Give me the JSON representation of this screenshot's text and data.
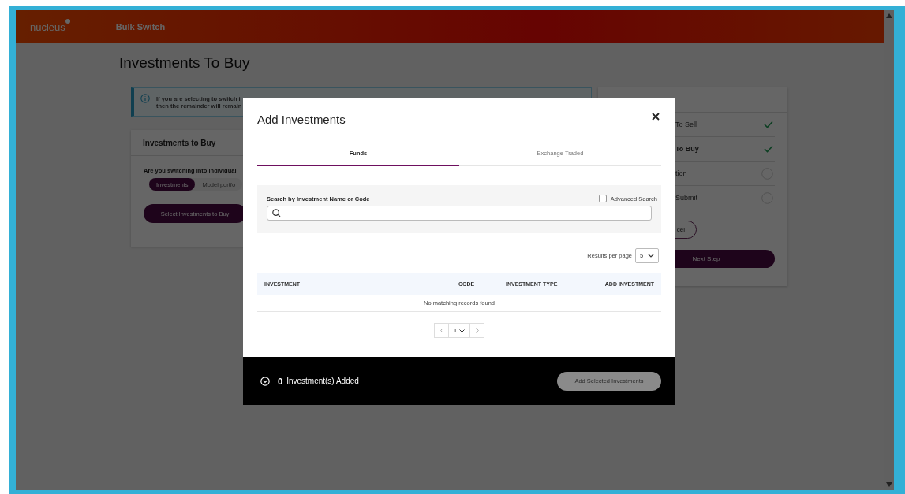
{
  "header": {
    "logo": "nucleus",
    "nav": "Bulk Switch"
  },
  "page": {
    "title": "Investments To Buy",
    "info_lines": [
      "If you are selecting to switch i",
      "then the remainder will remain"
    ],
    "card": {
      "title": "Investments to Buy",
      "question": "Are you switching into individual",
      "toggle": [
        {
          "label": "Investments",
          "selected": true
        },
        {
          "label": "Model portfo",
          "selected": false
        }
      ],
      "button": "Select Investments to Buy"
    },
    "steps": [
      {
        "label": "To Sell",
        "done": true,
        "current": false
      },
      {
        "label": "To Buy",
        "done": true,
        "current": true
      },
      {
        "label": "tion",
        "done": false,
        "current": false
      },
      {
        "label": "Submit",
        "done": false,
        "current": false
      }
    ],
    "cancel_button": "cel",
    "next_button": "Next Step"
  },
  "modal": {
    "title": "Add Investments",
    "tabs": [
      {
        "label": "Funds",
        "selected": true
      },
      {
        "label": "Exchange Traded",
        "selected": false
      }
    ],
    "search": {
      "label": "Search by Investment Name or Code",
      "advanced_search": {
        "label": "Advanced Search",
        "checked": false
      }
    },
    "results_per_page": {
      "label": "Results per page",
      "value": "5"
    },
    "table": {
      "columns": [
        "INVESTMENT",
        "CODE",
        "INVESTMENT TYPE",
        "ADD INVESTMENT"
      ],
      "empty_message": "No matching records found"
    },
    "pagination": {
      "page": "1"
    },
    "footer": {
      "count": "0",
      "label": "Investment(s) Added",
      "button": {
        "label": "Add Selected Investments",
        "disabled": true
      }
    }
  }
}
